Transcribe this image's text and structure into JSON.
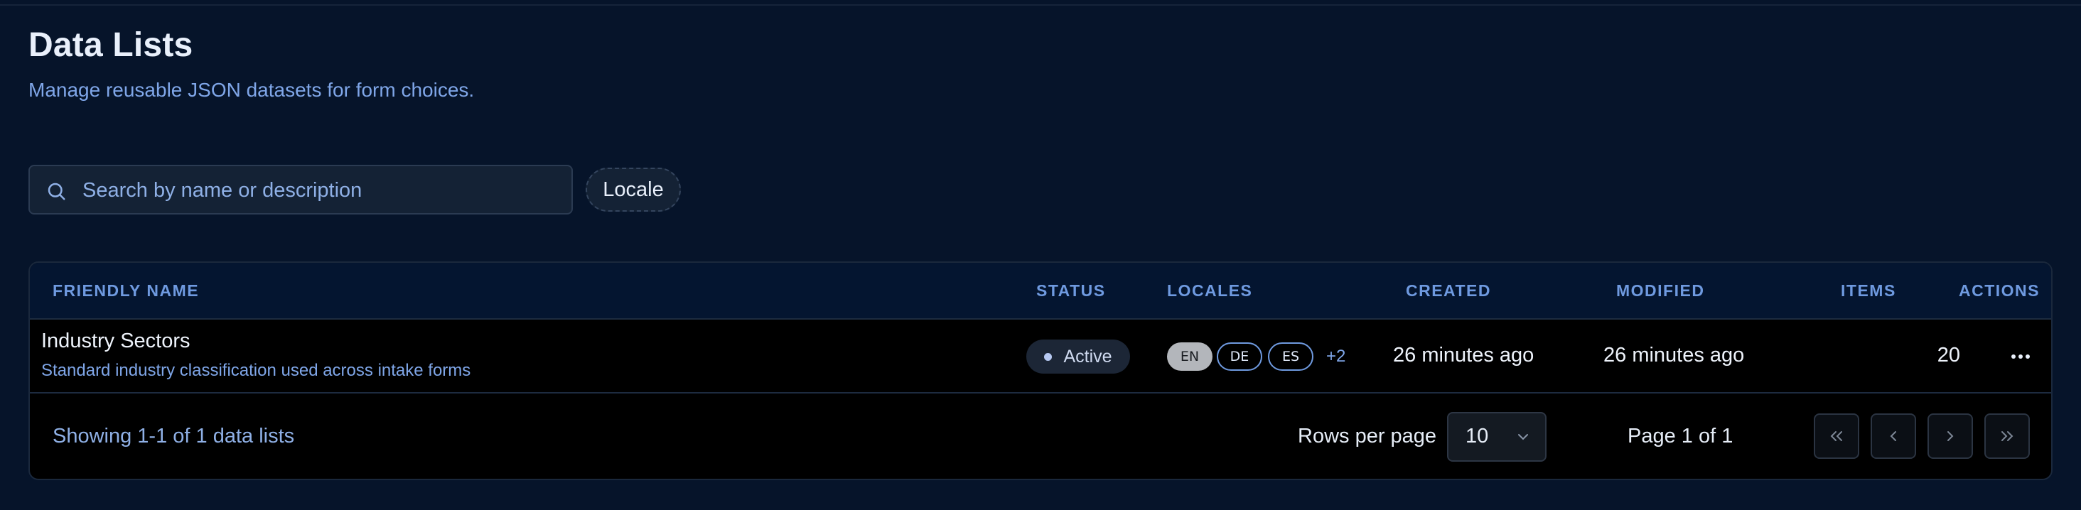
{
  "header": {
    "title": "Data Lists",
    "subtitle": "Manage reusable JSON datasets for form choices."
  },
  "filters": {
    "search_placeholder": "Search by name or description",
    "search_value": "",
    "locale_label": "Locale"
  },
  "table": {
    "columns": [
      "FRIENDLY NAME",
      "STATUS",
      "LOCALES",
      "CREATED",
      "MODIFIED",
      "ITEMS",
      "ACTIONS"
    ],
    "rows": [
      {
        "name": "Industry Sectors",
        "description": "Standard industry classification used across intake forms",
        "status": "Active",
        "locales": [
          "EN",
          "DE",
          "ES"
        ],
        "locales_more": "+2",
        "created": "26 minutes ago",
        "modified": "26 minutes ago",
        "items": "20"
      }
    ]
  },
  "footer": {
    "showing": "Showing 1-1 of 1 data lists",
    "rows_per_page_label": "Rows per page",
    "rows_per_page_value": "10",
    "page_label": "Page 1 of 1"
  },
  "icons": {
    "search": "search-icon",
    "chevron": "chevron-down-icon",
    "more": "more-horizontal-icon",
    "first": "chevrons-left-icon",
    "prev": "chevron-left-icon",
    "next": "chevron-right-icon",
    "last": "chevrons-right-icon"
  },
  "colors": {
    "background": "#06142a",
    "accent": "#6f9ae0",
    "table_bg": "#000000"
  }
}
